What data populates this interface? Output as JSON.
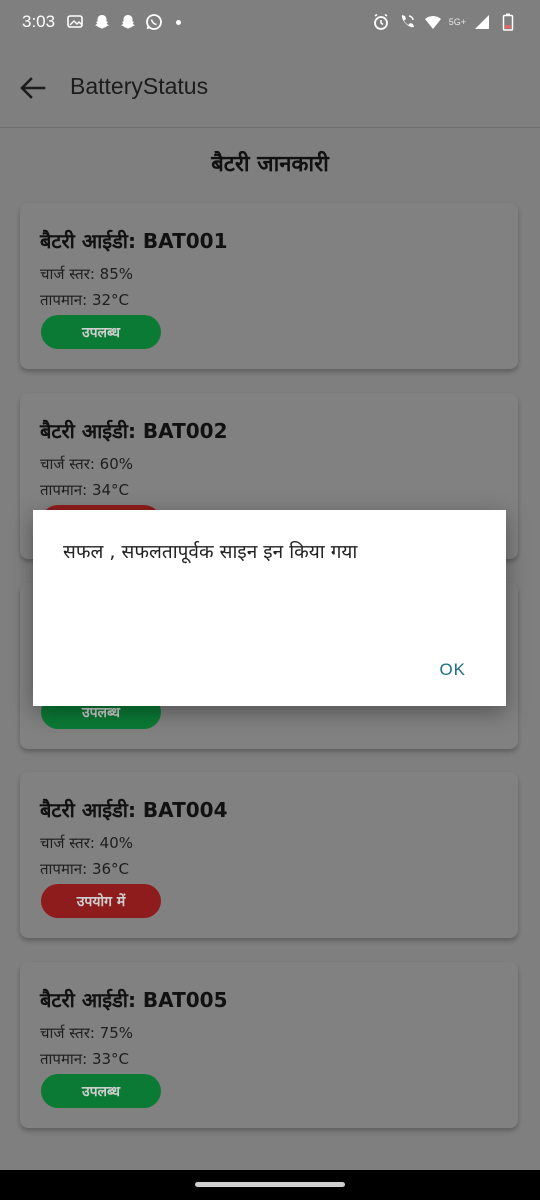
{
  "status_bar": {
    "time": "3:03",
    "network": "5G+",
    "left_icons": [
      "gallery-icon",
      "snapchat-icon",
      "snapchat-icon",
      "whatsapp-icon"
    ],
    "right_icons": [
      "alarm-icon",
      "wifi-call-icon",
      "wifi-icon",
      "signal-icon",
      "battery-icon"
    ]
  },
  "app_bar": {
    "title": "BatteryStatus",
    "back_icon": "arrow-left-icon"
  },
  "page": {
    "heading": "बैटरी जानकारी"
  },
  "batteries": [
    {
      "title": "बैटरी आईडी: BAT001",
      "charge": "चार्ज स्तर: 85%",
      "temp": "तापमान: 32°C",
      "status": "उपलब्ध",
      "status_type": "available"
    },
    {
      "title": "बैटरी आईडी: BAT002",
      "charge": "चार्ज स्तर: 60%",
      "temp": "तापमान: 34°C",
      "status": "",
      "status_type": "inuse"
    },
    {
      "title": "",
      "charge": "",
      "temp": "",
      "status": "उपलब्ध",
      "status_type": "available"
    },
    {
      "title": "बैटरी आईडी: BAT004",
      "charge": "चार्ज स्तर: 40%",
      "temp": "तापमान: 36°C",
      "status": "उपयोग में",
      "status_type": "inuse"
    },
    {
      "title": "बैटरी आईडी: BAT005",
      "charge": "चार्ज स्तर: 75%",
      "temp": "तापमान: 33°C",
      "status": "उपलब्ध",
      "status_type": "available"
    }
  ],
  "dialog": {
    "message": "सफल , सफलतापूर्वक साइन इन किया गया",
    "ok_label": "OK"
  },
  "colors": {
    "available": "#0b7a35",
    "in_use": "#8e1c1c",
    "dialog_button": "#1f6f86"
  }
}
